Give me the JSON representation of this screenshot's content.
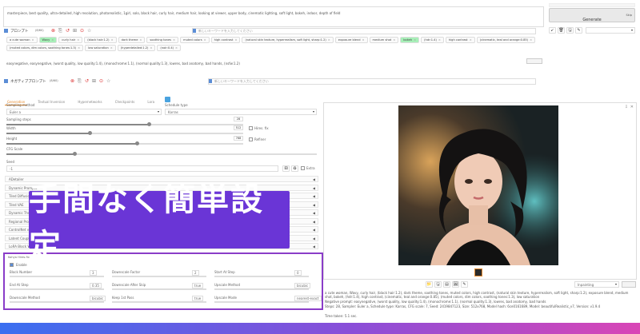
{
  "prompt": {
    "text": "masterpiece, best quality, ultra-detailed, high resolution, photorealistic, 1girl, solo, black hair, curly hair, medium hair, looking at viewer, upper body, cinematic lighting, soft light, bokeh, indoor, depth of field",
    "generate_label": "Generate",
    "skip_label": "Skip"
  },
  "prompt_panel": {
    "title": "プロンプト",
    "count": "(8/60)",
    "autocomplete_placeholder": "新しいキーワードを入力してください",
    "chips": [
      {
        "label": "a cute woman",
        "hl": false
      },
      {
        "label": "Wavy",
        "hl": true
      },
      {
        "label": "curly hair",
        "hl": false
      },
      {
        "label": "(black hair:1.2)",
        "hl": false
      },
      {
        "label": "dark theme",
        "hl": false
      },
      {
        "label": "soothing tones",
        "hl": false
      },
      {
        "label": "muted colors",
        "hl": false
      },
      {
        "label": "high contrast",
        "hl": false
      },
      {
        "label": "(natural skin texture, hyperrealism, soft light, sharp:1.2)",
        "hl": false
      },
      {
        "label": "exposure blend",
        "hl": false
      },
      {
        "label": "medium shot",
        "hl": false
      },
      {
        "label": "bokeh",
        "hl": true
      },
      {
        "label": "(hdr:1.4)",
        "hl": false
      },
      {
        "label": "high contrast",
        "hl": false
      },
      {
        "label": "(cinematic, teal and orange:0.85)",
        "hl": false
      },
      {
        "label": "(muted colors, dim colors, soothing tones:1.3)",
        "hl": false
      },
      {
        "label": "low saturation",
        "hl": false
      },
      {
        "label": "(hyperdetailed:1.2)",
        "hl": false
      },
      {
        "label": "(noir:0.4)",
        "hl": false
      }
    ],
    "raw_text": "easynegative, easynegative, (worst quality, low quality:1.4), (monochrome:1.1), (normal quality:1.3), lowres, bad anatomy, bad hands, (nsfw:1.2)"
  },
  "negative_panel": {
    "title": "ネガティブプロンプト",
    "count": "(8/60)",
    "autocomplete_placeholder": "新しいキーワードを入力してください"
  },
  "tabs": [
    "Generation",
    "Textual Inversion",
    "Hypernetworks",
    "Checkpoints",
    "Lora"
  ],
  "active_tab": 0,
  "settings": {
    "sampling_method_label": "Sampling method",
    "sampling_method_value": "Euler a",
    "schedule_type_label": "Schedule type",
    "schedule_type_value": "Karras",
    "sampling_steps_label": "Sampling steps",
    "sampling_steps_value": "28",
    "sampling_steps_pct": 60,
    "hires_label": "Hires. fix",
    "refiner_label": "Refiner",
    "width_label": "Width",
    "width_value": "512",
    "width_pct": 35,
    "height_label": "Height",
    "height_value": "768",
    "height_pct": 55,
    "batch_count_label": "Batch count",
    "batch_count_value": "1",
    "batch_size_label": "Batch size",
    "batch_size_value": "1",
    "cfg_label": "CFG Scale",
    "cfg_value": "7",
    "cfg_pct": 22,
    "seed_label": "Seed",
    "seed_value": "-1",
    "extra_label": "Extra"
  },
  "accordions": [
    "ADetailer",
    "Dynamic Prompts",
    "Tiled Diffusion",
    "Tiled VAE",
    "Dynamic Thresholding",
    "Regional Prompter",
    "ControlNet v1.1",
    "Latent Couple",
    "LoRA Block Weight"
  ],
  "overlay_text": "手間なく簡単設定",
  "bottom_section": {
    "title": "Kohya Hires.fix",
    "enable_label": "Enable",
    "fields_row1": [
      "Block Number",
      "Downscale Factor",
      "Start At Step"
    ],
    "vals_row1": [
      "3",
      "2",
      "0"
    ],
    "fields_row2": [
      "End At Step",
      "Downscale After Skip",
      "Upscale Method"
    ],
    "vals_row2": [
      "0.35",
      "true",
      "bicubic"
    ],
    "fields_row3": [
      "Downscale Method",
      "Keep 1st Pass",
      "Upscale Mode"
    ],
    "vals_row3": [
      "bicubic",
      "true",
      "nearest-exact"
    ]
  },
  "output": {
    "info_text": "a cute woman, Wavy, curly hair, (black hair:1.2), dark theme, soothing tones, muted colors, high contrast, (natural skin texture, hyperrealism, soft light, sharp:1.2), exposure blend, medium shot, bokeh, (hdr:1.4), high contrast, (cinematic, teal and orange:0.85), (muted colors, dim colors, soothing tones:1.3), low saturation",
    "negative_text": "Negative prompt: easynegative, (worst quality, low quality:1.4), (monochrome:1.1), (normal quality:1.3), lowres, bad anatomy, bad hands",
    "params_text": "Steps: 28, Sampler: Euler a, Schedule type: Karras, CFG scale: 7, Seed: 2419847123, Size: 512x768, Model hash: 6ce0161689, Model: beautifulRealistic_v7, Version: v1.9.4",
    "time_text": "Time taken: 5.1 sec.",
    "send_label": "Inpainting"
  },
  "colors": {
    "accent_orange": "#e58a2d",
    "overlay_purple": "#6a35d6",
    "highlight_green": "#a7f0b8",
    "frame_purple": "#8a3cc8",
    "generate_bg": "#e9e9e9"
  }
}
